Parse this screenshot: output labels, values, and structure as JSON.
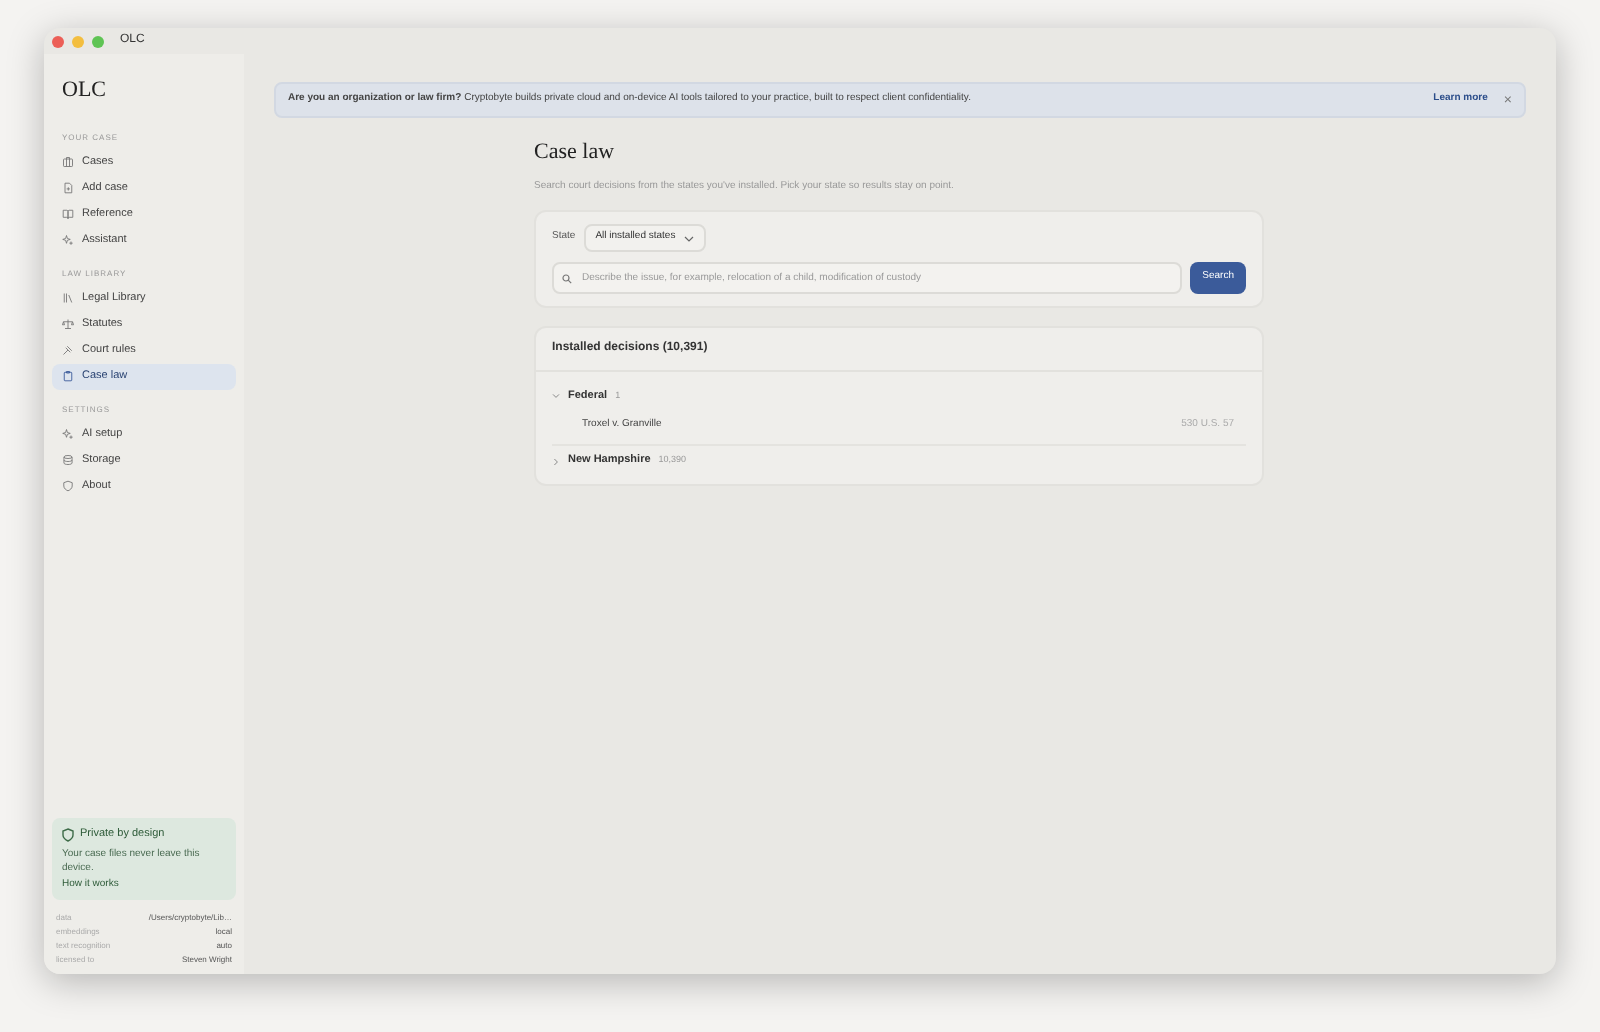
{
  "window": {
    "title": "OLC"
  },
  "sidebar": {
    "app_name": "OLC",
    "sections": [
      {
        "heading": "YOUR CASE",
        "items": [
          {
            "label": "Cases",
            "kind": "cases",
            "selected": false
          },
          {
            "label": "Add case",
            "kind": "add",
            "selected": false
          },
          {
            "label": "Reference",
            "kind": "book",
            "selected": false
          },
          {
            "label": "Assistant",
            "kind": "sparkle",
            "selected": false
          }
        ]
      },
      {
        "heading": "LAW LIBRARY",
        "items": [
          {
            "label": "Legal Library",
            "kind": "library",
            "selected": false
          },
          {
            "label": "Statutes",
            "kind": "scale",
            "selected": false
          },
          {
            "label": "Court rules",
            "kind": "gavel",
            "selected": false
          },
          {
            "label": "Case law",
            "kind": "clipboard",
            "selected": true
          }
        ]
      },
      {
        "heading": "SETTINGS",
        "items": [
          {
            "label": "AI setup",
            "kind": "sparkle",
            "selected": false
          },
          {
            "label": "Storage",
            "kind": "storage",
            "selected": false
          },
          {
            "label": "About",
            "kind": "shield",
            "selected": false
          }
        ]
      }
    ],
    "privacy_card": {
      "title": "Private by design",
      "text": "Your case files never leave this device.",
      "link": "How it works"
    },
    "info": [
      {
        "label": "data",
        "value": "/Users/cryptobyte/Lib…"
      },
      {
        "label": "embeddings",
        "value": "local"
      },
      {
        "label": "text recognition",
        "value": "auto"
      },
      {
        "label": "licensed to",
        "value": "Steven Wright"
      }
    ]
  },
  "banner": {
    "text": "**Are you an organization or law firm?** Cryptobyte builds private cloud and on-device AI tools tailored to your practice, built to respect client confidentiality.",
    "link": "Learn more",
    "close": "×"
  },
  "page": {
    "title": "Case law",
    "subtitle": "Search court decisions from the states you've installed. Pick your state so results stay on point.",
    "state_label": "State",
    "state_value": "All installed states",
    "search": {
      "placeholder": "Describe the issue, for example, relocation of a child, modification of custody",
      "button": "Search"
    }
  },
  "decisions": {
    "title": "Installed decisions (10,391)",
    "groups": [
      {
        "name": "Federal",
        "count": "1",
        "expanded": true,
        "cases": [
          {
            "name": "Troxel v. Granville",
            "citation": "530 U.S. 57"
          }
        ]
      },
      {
        "name": "New Hampshire",
        "count": "10,390",
        "expanded": false
      }
    ]
  }
}
